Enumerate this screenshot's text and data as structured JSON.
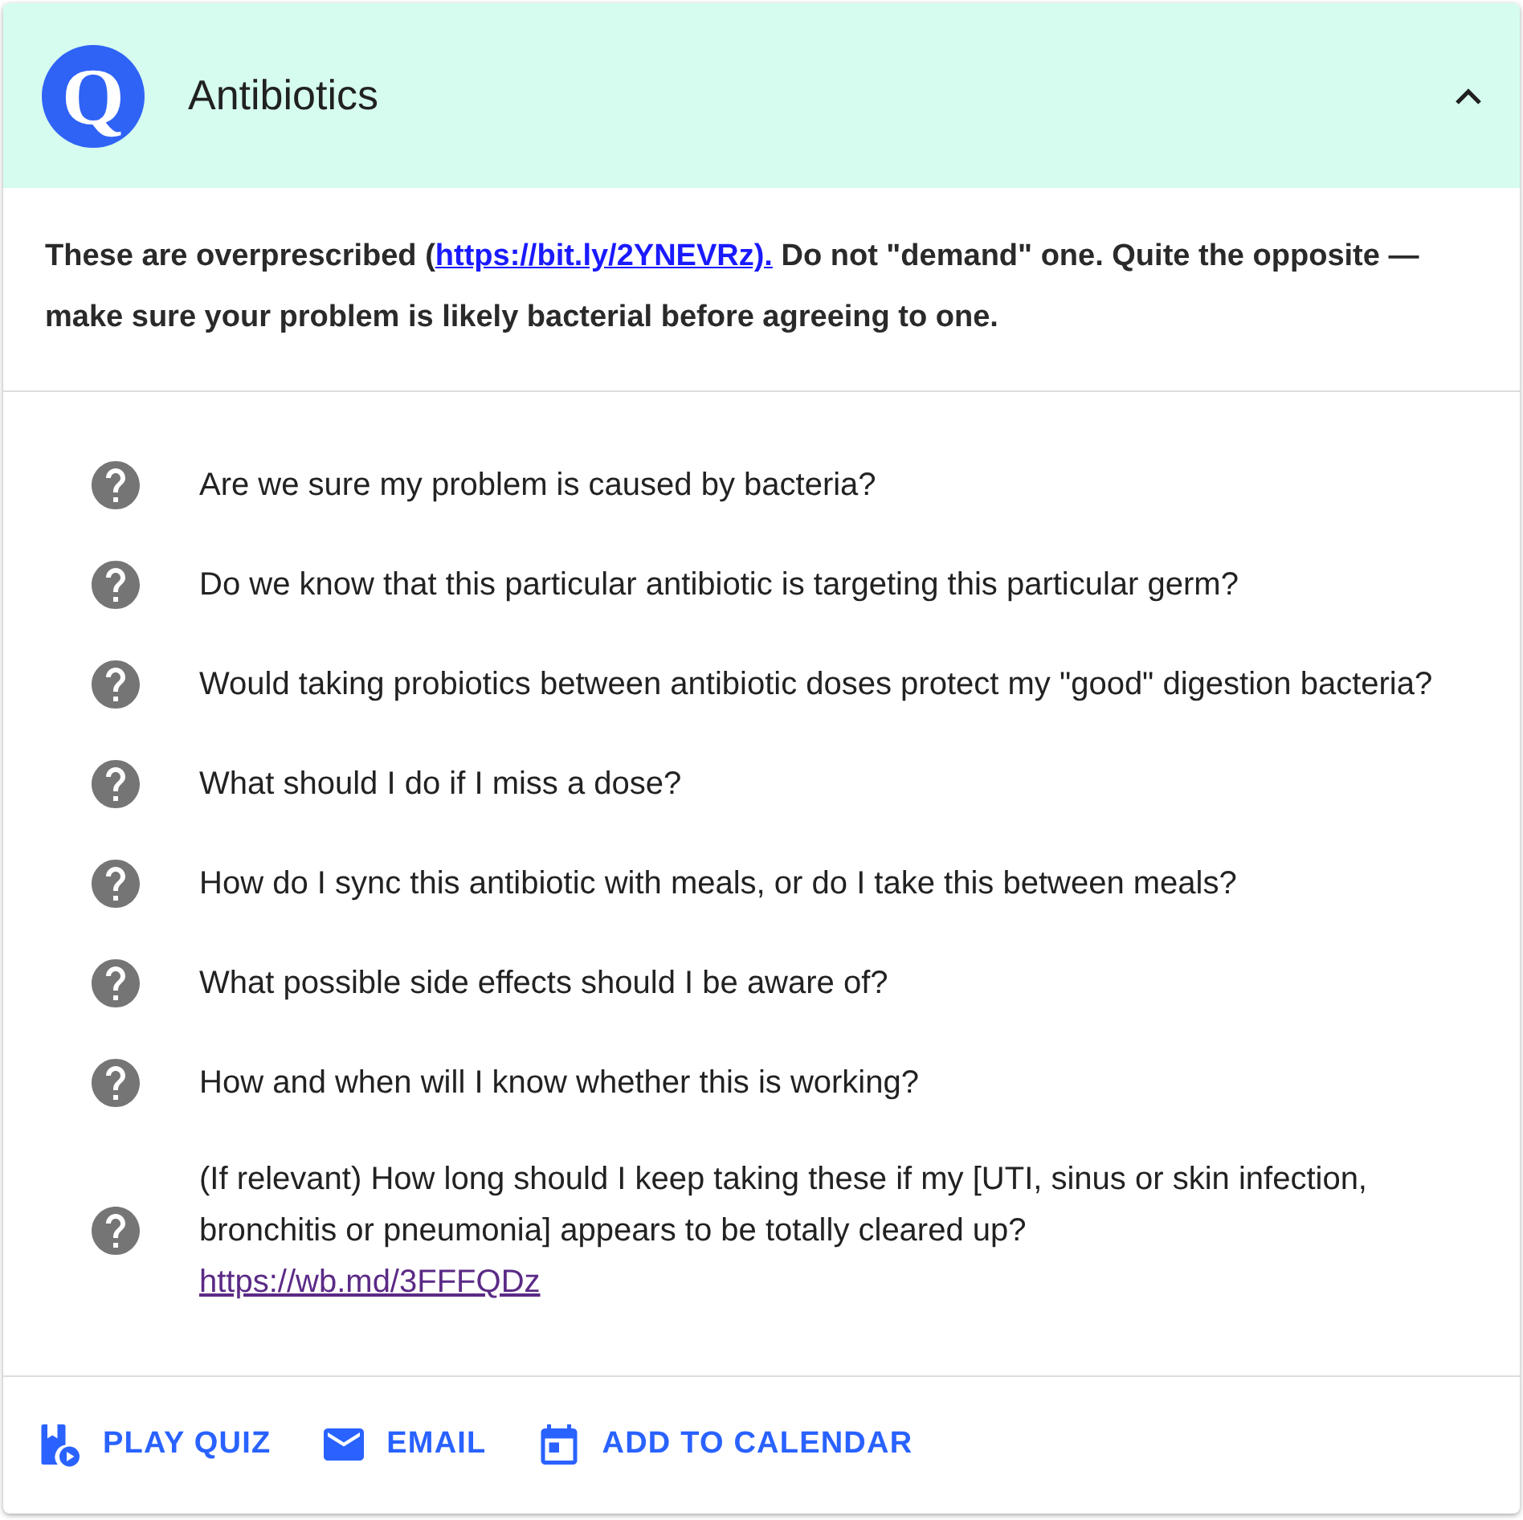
{
  "card": {
    "logo": "Q",
    "title": "Antibiotics",
    "expanded": true
  },
  "intro": {
    "before": "These are overprescribed (",
    "link": "https://bit.ly/2YNEVRz).",
    "after": " Do not \"demand\" one. Quite the opposite — make sure your problem is likely bacterial before agreeing to one."
  },
  "questions": [
    {
      "text": "Are we sure my problem is caused by bacteria?"
    },
    {
      "text": "Do we know that this particular antibiotic is targeting this particular germ?"
    },
    {
      "text": "Would taking probiotics between antibiotic doses protect my \"good\" digestion bacteria?"
    },
    {
      "text": "What should I do if I miss a dose?"
    },
    {
      "text": "How do I sync this antibiotic with meals, or do I take this between meals?"
    },
    {
      "text": "What possible side effects should I be aware of?"
    },
    {
      "text": "How and when will I know whether this is working?"
    },
    {
      "text": "(If relevant) How long should I keep taking these if my [UTI, sinus or skin infection, bronchitis or pneumonia] appears to be totally cleared up?",
      "link": "https://wb.md/3FFFQDz"
    }
  ],
  "actions": [
    {
      "kind": "quiz",
      "label": "PLAY QUIZ"
    },
    {
      "kind": "email",
      "label": "EMAIL"
    },
    {
      "kind": "calendar",
      "label": "ADD TO CALENDAR"
    }
  ]
}
